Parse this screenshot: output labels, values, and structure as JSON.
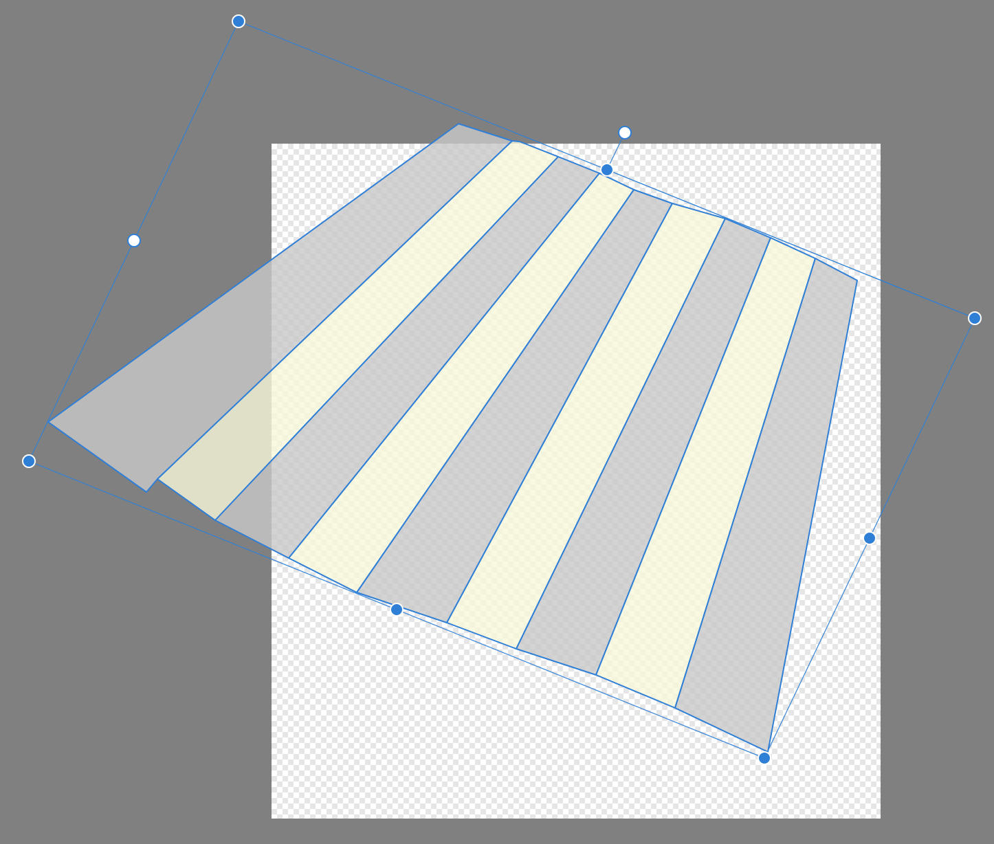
{
  "canvas": {
    "background_color": "#808080",
    "artboard_fill": "transparent-checkerboard"
  },
  "object": {
    "type": "striped-shape-under-distort-transform",
    "stripe_colors": [
      "#c8c8c8",
      "#f7f7d9"
    ],
    "stripe_opacity": 0.8
  },
  "transform_box": {
    "stroke_color": "#2f7fd6",
    "handle_fill": "#2f7fd6",
    "handle_hollow_fill": "#ffffff",
    "handles": [
      {
        "name": "corner-handle-top-left",
        "style": "filled"
      },
      {
        "name": "corner-handle-top-right",
        "style": "filled"
      },
      {
        "name": "corner-handle-bottom-right",
        "style": "filled"
      },
      {
        "name": "corner-handle-bottom-left",
        "style": "filled"
      },
      {
        "name": "edge-handle-left",
        "style": "hollow"
      },
      {
        "name": "edge-handle-top",
        "style": "filled"
      },
      {
        "name": "edge-handle-right",
        "style": "filled"
      },
      {
        "name": "edge-handle-bottom",
        "style": "filled"
      },
      {
        "name": "rotate-handle",
        "style": "hollow"
      }
    ]
  }
}
